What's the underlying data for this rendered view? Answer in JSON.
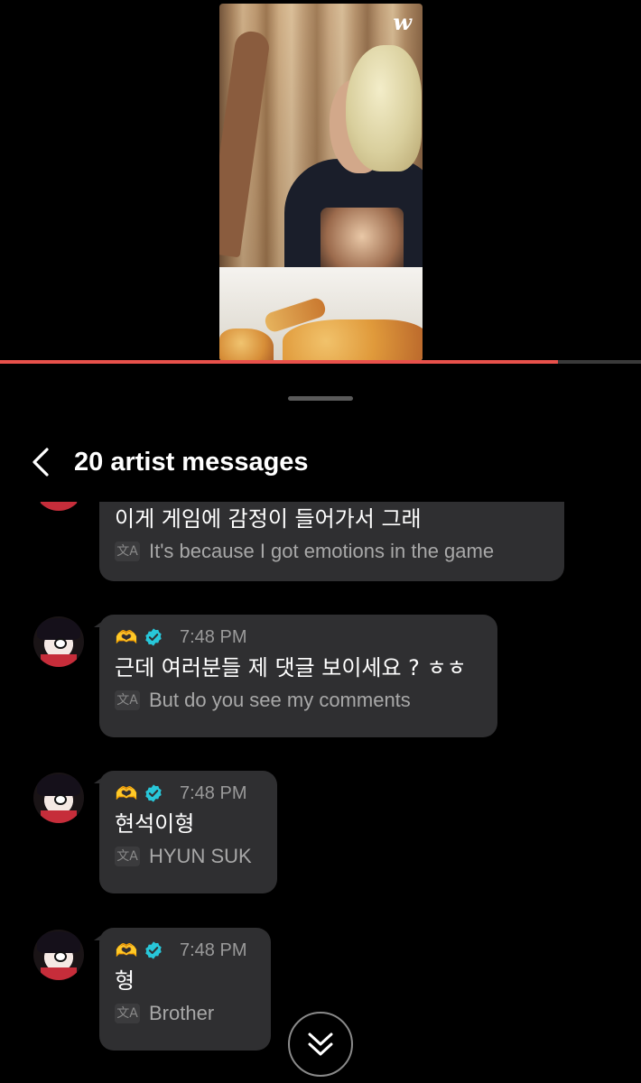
{
  "video": {
    "logo": "w",
    "progress_percent": 87
  },
  "header": {
    "title": "20 artist messages"
  },
  "messages": [
    {
      "time": "",
      "original": "이게 게임에 감정이 들어가서 그래",
      "translation": "It's because I got emotions in the game",
      "partially_visible": true
    },
    {
      "time": "7:48 PM",
      "original": "근데 여러분들 제 댓글 보이세요 ? ㅎㅎ",
      "translation": "But do you see my comments"
    },
    {
      "time": "7:48 PM",
      "original": "현석이형",
      "translation": "HYUN SUK"
    },
    {
      "time": "7:48 PM",
      "original": "형",
      "translation": "Brother"
    }
  ],
  "icons": {
    "back": "chevron-left-icon",
    "verified": "verified-badge-icon",
    "hands": "heart-hands-icon",
    "translate": "translate-icon",
    "scroll": "double-chevron-down-icon"
  },
  "colors": {
    "background": "#000000",
    "bubble": "#2f2f31",
    "accent_progress": "#e8514b",
    "verified": "#28c7d9",
    "muted_text": "#a8a8a8"
  }
}
